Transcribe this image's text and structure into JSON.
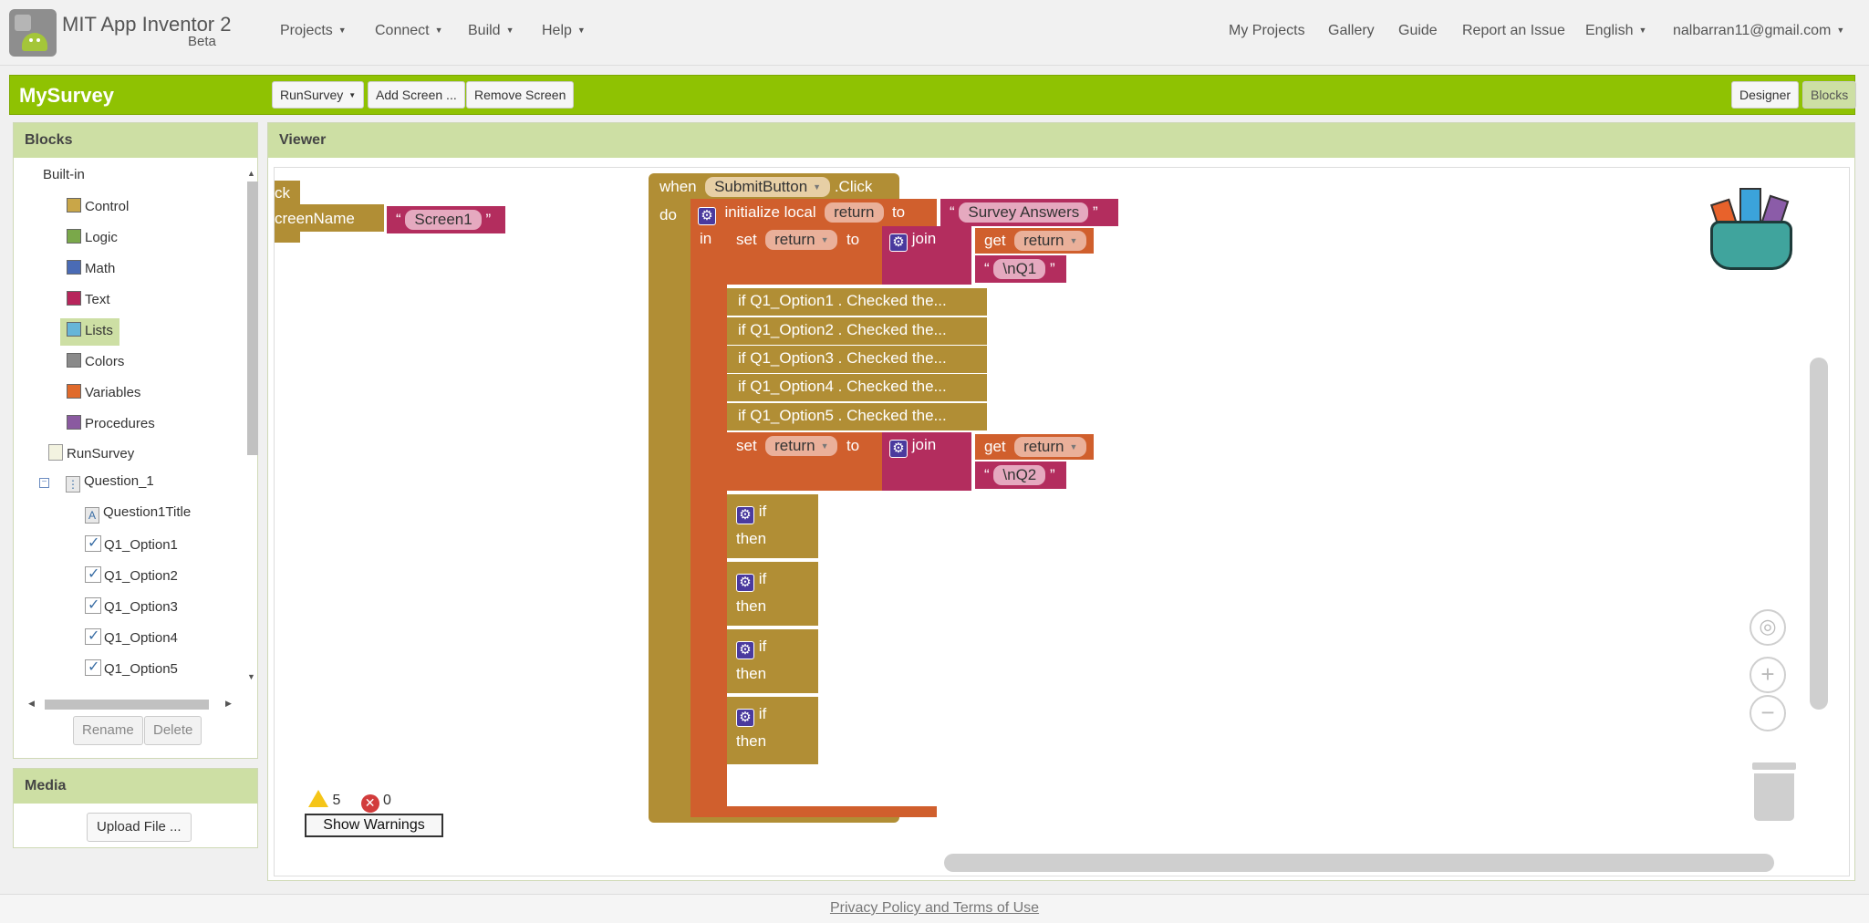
{
  "app": {
    "name": "MIT App Inventor 2",
    "edition": "Beta"
  },
  "nav": {
    "left": [
      {
        "label": "Projects"
      },
      {
        "label": "Connect"
      },
      {
        "label": "Build"
      },
      {
        "label": "Help"
      }
    ],
    "right": {
      "my_projects": "My Projects",
      "gallery": "Gallery",
      "guide": "Guide",
      "report": "Report an Issue",
      "language": "English",
      "account": "nalbarran11@gmail.com"
    }
  },
  "project": {
    "name": "MySurvey",
    "screen_selector": "RunSurvey",
    "add_screen": "Add Screen ...",
    "remove_screen": "Remove Screen",
    "designer": "Designer",
    "blocks": "Blocks"
  },
  "blocks_panel": {
    "title": "Blocks",
    "builtin_label": "Built-in",
    "builtin": [
      {
        "label": "Control",
        "color": "#c9a648"
      },
      {
        "label": "Logic",
        "color": "#7aa84a"
      },
      {
        "label": "Math",
        "color": "#4a6bb5"
      },
      {
        "label": "Text",
        "color": "#b7255b"
      },
      {
        "label": "Lists",
        "color": "#66b5d8"
      },
      {
        "label": "Colors",
        "color": "#8a8a8a"
      },
      {
        "label": "Variables",
        "color": "#e06a2b"
      },
      {
        "label": "Procedures",
        "color": "#8a5aa0"
      }
    ],
    "screen": "RunSurvey",
    "arrangement": "Question_1",
    "children": [
      "Question1Title",
      "Q1_Option1",
      "Q1_Option2",
      "Q1_Option3",
      "Q1_Option4",
      "Q1_Option5"
    ],
    "rename": "Rename",
    "delete": "Delete"
  },
  "media_panel": {
    "title": "Media",
    "upload": "Upload File ..."
  },
  "viewer": {
    "title": "Viewer",
    "partial_block": {
      "top": "ck",
      "param": "creenName",
      "value": "Screen1"
    },
    "event": {
      "when": "when",
      "component": "SubmitButton",
      "event": ".Click",
      "do": "do"
    },
    "local": {
      "init": "initialize local",
      "var": "return",
      "to": "to",
      "in": "in",
      "value": "Survey Answers"
    },
    "set1": {
      "set": "set",
      "var": "return",
      "to": "to",
      "join": "join",
      "get": "get",
      "get_var": "return",
      "text": "\\nQ1"
    },
    "checks": [
      "if Q1_Option1 . Checked the...",
      "if Q1_Option2 . Checked the...",
      "if Q1_Option3 . Checked the...",
      "if Q1_Option4 . Checked the...",
      "if Q1_Option5 . Checked the..."
    ],
    "set2": {
      "set": "set",
      "var": "return",
      "to": "to",
      "join": "join",
      "get": "get",
      "get_var": "return",
      "text": "\\nQ2"
    },
    "if_blocks": [
      {
        "if": "if",
        "then": "then"
      },
      {
        "if": "if",
        "then": "then"
      },
      {
        "if": "if",
        "then": "then"
      },
      {
        "if": "if",
        "then": "then"
      }
    ],
    "warnings": {
      "count": "5",
      "errors": "0",
      "show": "Show Warnings"
    }
  },
  "footer": {
    "link": "Privacy Policy and Terms of Use"
  },
  "colors": {
    "green": "#8fc202",
    "control": "#b18e35",
    "variable": "#d05f2d",
    "text": "#b32d5e"
  }
}
